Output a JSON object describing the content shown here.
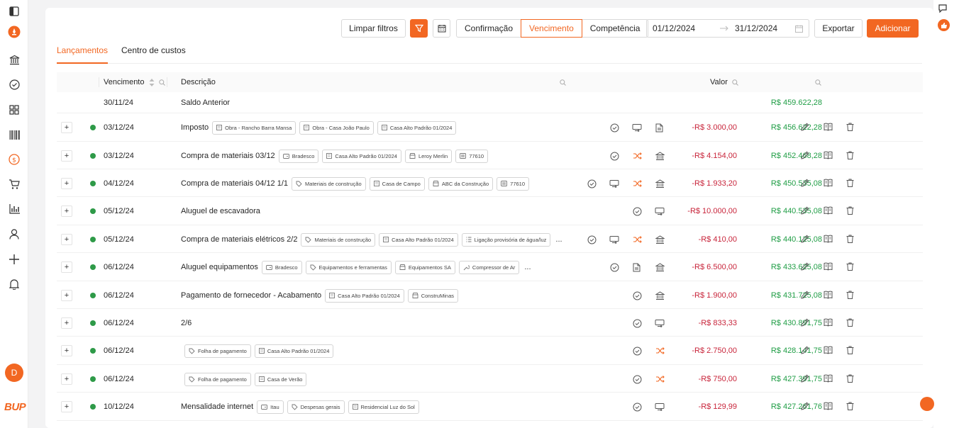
{
  "sidebar": {
    "icons": [
      "panel-toggle-icon",
      "brand-rocket-icon",
      "bank-icon",
      "check-circle-icon",
      "grid-icon",
      "barcode-icon",
      "dollar-circle-icon",
      "cart-icon",
      "bar-chart-icon",
      "user-icon",
      "plus-icon",
      "bell-icon"
    ],
    "avatar_letter": "D",
    "logo_text": "BUP",
    "accent_color": "#f26722"
  },
  "toolbar": {
    "clear_filters": "Limpar filtros",
    "date_modes": [
      "Confirmação",
      "Vencimento",
      "Competência"
    ],
    "active_date_mode": "Vencimento",
    "date_start": "01/12/2024",
    "date_end": "31/12/2024",
    "export_label": "Exportar",
    "add_label": "Adicionar"
  },
  "tabs": [
    "Lançamentos",
    "Centro de custos"
  ],
  "table": {
    "col_vencimento": "Vencimento",
    "col_descricao": "Descrição",
    "col_valor": "Valor"
  },
  "opening": {
    "date": "30/11/24",
    "description": "Saldo Anterior",
    "balance": "R$ 459.622,28"
  },
  "rows": [
    {
      "date": "03/12/24",
      "description": "Imposto",
      "tags": [
        [
          "building",
          "Obra - Rancho Barra Mansa"
        ],
        [
          "building",
          "Obra - Casa João Paulo"
        ],
        [
          "building",
          "Casa Alto Padrão 01/2024"
        ]
      ],
      "more": "",
      "icons": [
        [
          "check",
          859
        ],
        [
          "transfer",
          891
        ],
        [
          "doc",
          923
        ]
      ],
      "value": "-R$ 3.000,00",
      "balance": "R$ 456.622,28"
    },
    {
      "date": "03/12/24",
      "description": "Compra de materiais 03/12",
      "tags": [
        [
          "card",
          "Bradesco"
        ],
        [
          "building",
          "Casa Alto Padrão 01/2024"
        ],
        [
          "store",
          "Leroy Merlin"
        ],
        [
          "tagid",
          "77610"
        ]
      ],
      "more": "",
      "icons": [
        [
          "check",
          859
        ],
        [
          "shuffle",
          891
        ],
        [
          "bank",
          923
        ]
      ],
      "value": "-R$ 4.154,00",
      "balance": "R$ 452.468,28"
    },
    {
      "date": "04/12/24",
      "description": "Compra de materiais 04/12 1/1",
      "tags": [
        [
          "label",
          "Materiais de construção"
        ],
        [
          "building",
          "Casa de Campo"
        ],
        [
          "store",
          "ABC da Construção"
        ],
        [
          "tagid",
          "77610"
        ]
      ],
      "more": "",
      "icons": [
        [
          "check",
          827
        ],
        [
          "transfer",
          859
        ],
        [
          "shuffle",
          891
        ],
        [
          "bank",
          923
        ]
      ],
      "value": "-R$ 1.933,20",
      "balance": "R$ 450.535,08"
    },
    {
      "date": "05/12/24",
      "description": "Aluguel de escavadora",
      "tags": [],
      "more": "",
      "icons": [
        [
          "check",
          891
        ],
        [
          "transfer",
          923
        ]
      ],
      "value": "-R$ 10.000,00",
      "balance": "R$ 440.535,08"
    },
    {
      "date": "05/12/24",
      "description": "Compra de materiais elétricos 2/2",
      "tags": [
        [
          "label",
          "Materiais de construção"
        ],
        [
          "building",
          "Casa Alto Padrão 01/2024"
        ],
        [
          "list",
          "Ligação provisória de água/luz"
        ]
      ],
      "more": "...",
      "icons": [
        [
          "check",
          827
        ],
        [
          "transfer",
          859
        ],
        [
          "shuffle",
          891
        ],
        [
          "bank",
          923
        ]
      ],
      "value": "-R$ 410,00",
      "balance": "R$ 440.125,08"
    },
    {
      "date": "06/12/24",
      "description": "Aluguel equipamentos",
      "tags": [
        [
          "card",
          "Bradesco"
        ],
        [
          "label",
          "Equipamentos e ferramentas"
        ],
        [
          "store",
          "Equipamentos SA"
        ],
        [
          "tool",
          "Compressor de Ar"
        ]
      ],
      "more": "...",
      "icons": [
        [
          "check",
          859
        ],
        [
          "doc",
          891
        ],
        [
          "bank",
          923
        ]
      ],
      "value": "-R$ 6.500,00",
      "balance": "R$ 433.625,08"
    },
    {
      "date": "06/12/24",
      "description": "Pagamento de fornecedor - Acabamento",
      "tags": [
        [
          "building",
          "Casa Alto Padrão 01/2024"
        ],
        [
          "store",
          "ConstruMinas"
        ]
      ],
      "more": "",
      "icons": [
        [
          "check",
          891
        ],
        [
          "bank",
          923
        ]
      ],
      "value": "-R$ 1.900,00",
      "balance": "R$ 431.725,08"
    },
    {
      "date": "06/12/24",
      "description": "2/6",
      "tags": [],
      "more": "",
      "icons": [
        [
          "check",
          891
        ],
        [
          "transfer",
          923
        ]
      ],
      "value": "-R$ 833,33",
      "balance": "R$ 430.891,75"
    },
    {
      "date": "06/12/24",
      "description": "",
      "tags": [
        [
          "label",
          "Folha de pagamento"
        ],
        [
          "building",
          "Casa Alto Padrão 01/2024"
        ]
      ],
      "more": "",
      "icons": [
        [
          "check",
          891
        ],
        [
          "shuffle",
          923
        ]
      ],
      "value": "-R$ 2.750,00",
      "balance": "R$ 428.141,75"
    },
    {
      "date": "06/12/24",
      "description": "",
      "tags": [
        [
          "label",
          "Folha de pagamento"
        ],
        [
          "building",
          "Casa de Verão"
        ]
      ],
      "more": "",
      "icons": [
        [
          "check",
          891
        ],
        [
          "shuffle",
          923
        ]
      ],
      "value": "-R$ 750,00",
      "balance": "R$ 427.391,75"
    },
    {
      "date": "10/12/24",
      "description": "Mensalidade internet",
      "tags": [
        [
          "card",
          "Itau"
        ],
        [
          "label",
          "Despesas gerais"
        ],
        [
          "building",
          "Residencial Luz do Sol"
        ]
      ],
      "more": "",
      "icons": [
        [
          "check",
          891
        ],
        [
          "transfer",
          923
        ]
      ],
      "value": "-R$ 129,99",
      "balance": "R$ 427.261,76"
    }
  ],
  "colors": {
    "negative": "#c8243a",
    "positive": "#1f9d45",
    "status_dot": "#2e9a48"
  }
}
